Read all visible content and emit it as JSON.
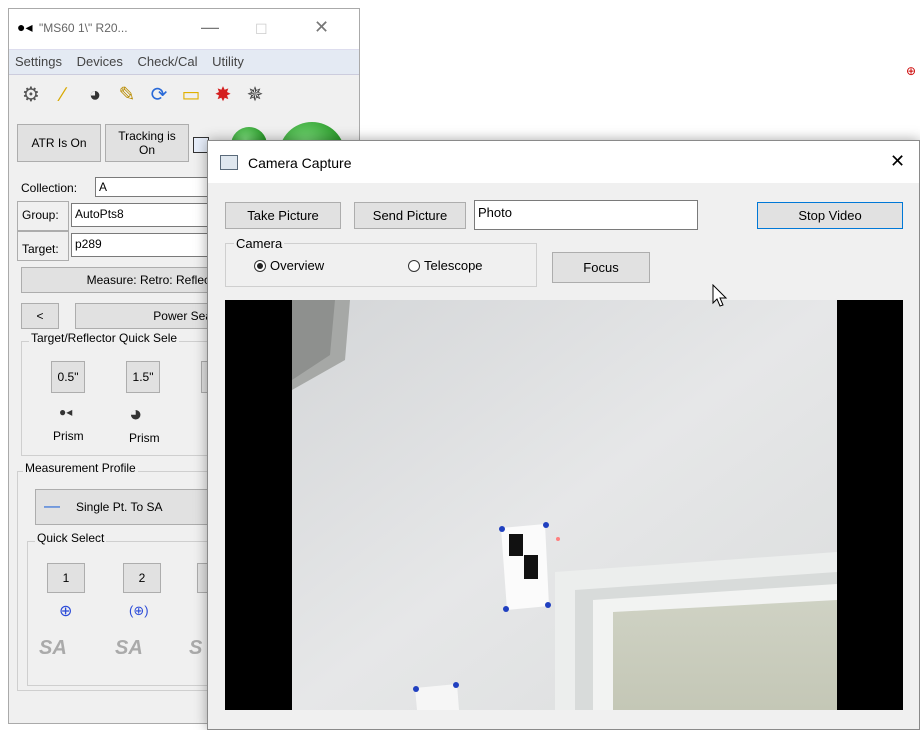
{
  "main_window": {
    "title": "\"MS60 1\\\" R20...",
    "minimize": "—",
    "maximize": "☐",
    "close": "✕",
    "menu": [
      "Settings",
      "Devices",
      "Check/Cal",
      "Utility"
    ],
    "atr_button": "ATR Is On",
    "tracking_button_line1": "Tracking is",
    "tracking_button_line2": "On",
    "collection_label": "Collection:",
    "collection_value": "A",
    "group_label": "Group:",
    "group_value": "AutoPts8",
    "target_label": "Target:",
    "target_value": "p289",
    "measure_button": "Measure: Retro: Reflec",
    "back_button": "<",
    "power_search_button": "Power Sea",
    "target_reflector_title": "Target/Reflector Quick Sele",
    "reflector_buttons": [
      "0.5\"",
      "1.5\""
    ],
    "prism_labels": [
      "Prism",
      "Prism"
    ],
    "measurement_profile_title": "Measurement Profile",
    "profile_button": "Single Pt. To SA",
    "quick_select_title": "Quick Select",
    "quick_buttons": [
      "1",
      "2"
    ],
    "sa_logo": "SA"
  },
  "camera_dialog": {
    "title": "Camera Capture",
    "close": "✕",
    "take_picture": "Take Picture",
    "send_picture": "Send Picture",
    "photo_name": "Photo",
    "stop_video": "Stop Video",
    "camera_group": "Camera",
    "overview_label": "Overview",
    "telescope_label": "Telescope",
    "overview_selected": true,
    "focus": "Focus"
  },
  "icons": [
    "camera-icon",
    "laser-pointer-icon",
    "prism-icon",
    "satellite-icon",
    "refresh-icon",
    "folder-icon",
    "burst-icon",
    "magic-wand-icon",
    "crosshair-icon"
  ]
}
